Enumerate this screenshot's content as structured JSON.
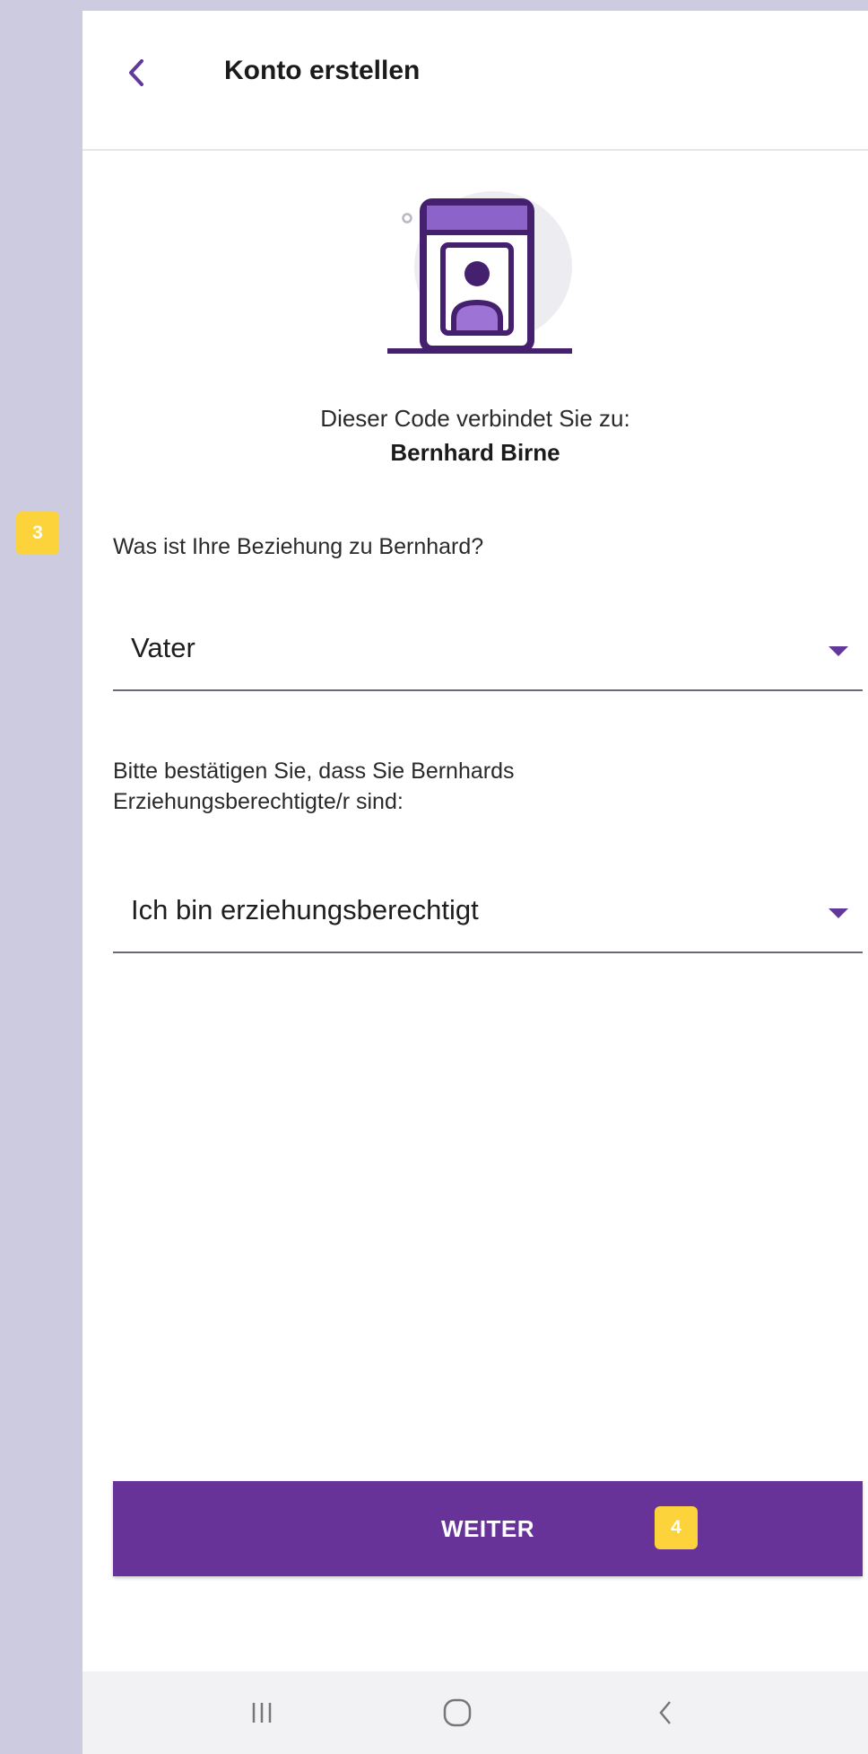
{
  "appbar": {
    "title": "Konto erstellen"
  },
  "intro": {
    "line1": "Dieser Code verbindet Sie zu:",
    "name": "Bernhard Birne"
  },
  "relationship": {
    "label": "Was ist Ihre Beziehung zu Bernhard?",
    "value": "Vater"
  },
  "guardian": {
    "label_line1": "Bitte bestätigen Sie, dass Sie Bernhards",
    "label_line2": "Erziehungsberechtigte/r sind:",
    "value": "Ich bin erziehungsberechtigt"
  },
  "cta": {
    "label": "WEITER"
  },
  "badges": {
    "step3": "3",
    "step4": "4"
  },
  "colors": {
    "primary": "#673399",
    "badge": "#fcd33a",
    "backdrop": "#cdcbe0"
  },
  "icons": [
    "back-arrow-icon",
    "profile-window-icon",
    "dropdown-caret-icon",
    "recent-apps-icon",
    "home-icon",
    "back-nav-icon"
  ]
}
